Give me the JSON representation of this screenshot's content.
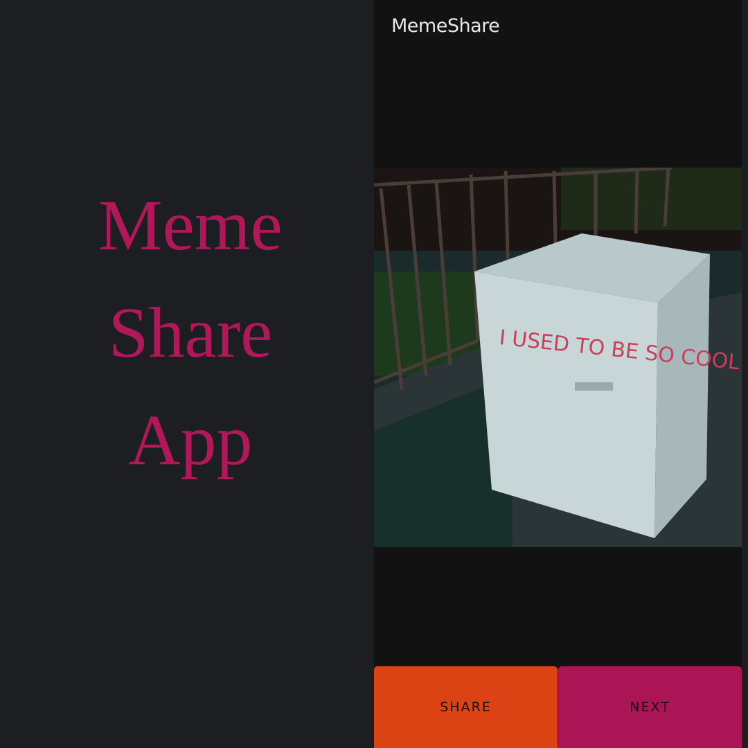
{
  "promo": {
    "title_lines": [
      "Meme",
      "Share",
      "App"
    ]
  },
  "app": {
    "title": "MemeShare",
    "meme_image": {
      "caption_text": "I USED TO BE SO COOL"
    },
    "buttons": {
      "share": "SHARE",
      "next": "NEXT"
    }
  },
  "colors": {
    "accent": "#b0185a",
    "share": "#db4314",
    "next": "#ab1556",
    "background": "#1d1e22",
    "app_background": "#121212"
  }
}
